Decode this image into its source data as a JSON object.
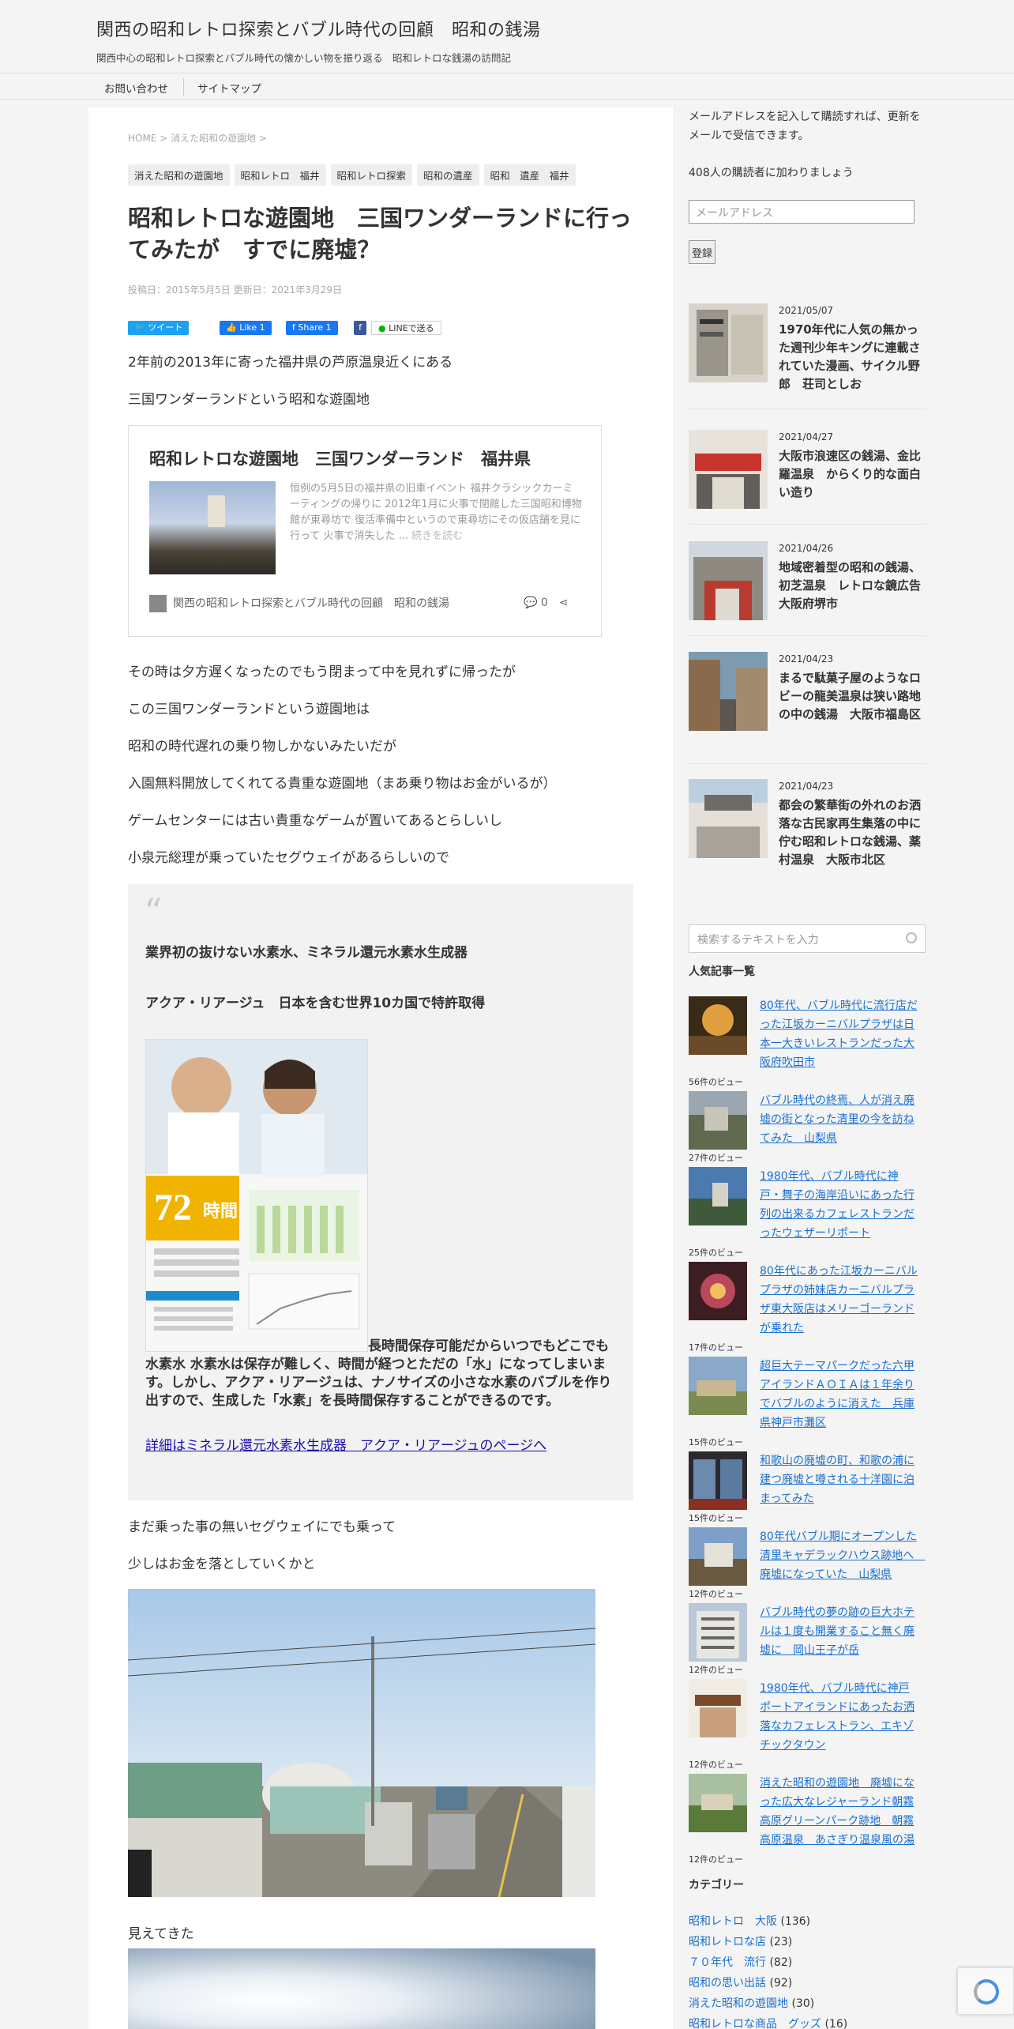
{
  "site": {
    "title": "関西の昭和レトロ探索とバブル時代の回顧　昭和の銭湯",
    "description": "関西中心の昭和レトロ探索とバブル時代の懐かしい物を振り返る　昭和レトロな銭湯の訪問記"
  },
  "nav": {
    "items": [
      {
        "label": "お問い合わせ"
      },
      {
        "label": "サイトマップ"
      }
    ]
  },
  "breadcrumb": {
    "home": "HOME",
    "sep": ">",
    "category": "消えた昭和の遊園地"
  },
  "tags": [
    "消えた昭和の遊園地",
    "昭和レトロ　福井",
    "昭和レトロ探索",
    "昭和の遺産",
    "昭和　遺産　福井"
  ],
  "post": {
    "title": "昭和レトロな遊園地　三国ワンダーランドに行ってみたが　すでに廃墟？",
    "date": "投稿日：2015年5月5日 更新日：2021年3月29日"
  },
  "share": {
    "tweet": "ツイート",
    "like": "Like 1",
    "fb_share": "Share 1",
    "line": "LINEで送る"
  },
  "paragraphs": {
    "p1": "2年前の2013年に寄った福井県の芦原温泉近くにある",
    "p2": "三国ワンダーランドという昭和な遊園地",
    "p3": "その時は夕方遅くなったのでもう閉まって中を見れずに帰ったが",
    "p4": "この三国ワンダーランドという遊園地は",
    "p5": "昭和の時代遅れの乗り物しかないみたいだが",
    "p6": "入園無料開放してくれてる貴重な遊園地（まあ乗り物はお金がいるが）",
    "p7": "ゲームセンターには古い貴重なゲームが置いてあるとらしいし",
    "p8": "小泉元総理が乗っていたセグウェイがあるらしいので",
    "p9": "まだ乗った事の無いセグウェイにでも乗って",
    "p10": "少しはお金を落としていくかと",
    "p11": "見えてきた"
  },
  "card": {
    "title": "昭和レトロな遊園地　三国ワンダーランド　福井県",
    "excerpt": "恒例の5月5日の福井県の旧車イベント 福井クラシックカーミーティングの帰りに 2012年1月に火事で閉館した三国昭和博物館が東尋坊で 復活準備中というので東尋坊にその仮店舗を見に行って 火事で消失した ...",
    "more": "続きを読む",
    "site": "関西の昭和レトロ探索とバブル時代の回顧　昭和の銭湯",
    "comments": "0"
  },
  "promo": {
    "heading1": "業界初の抜けない水素水、ミネラル還元水素水生成器",
    "heading2": "アクア・リアージュ　日本を含む世界10カ国で特許取得",
    "image_big_number": "72",
    "image_unit": "時間",
    "body": "長時間保存可能だからいつでもどこでも水素水 水素水は保存が難しく、時間が経つとただの「水」になってしまいます。しかし、アクア・リアージュは、ナノサイズの小さな水素のバブルを作り出すので、生成した「水素」を長時間保存することができるのです。",
    "link": "詳細はミネラル還元水素水生成器　アクア・リアージュのページへ"
  },
  "sidebar": {
    "subscribe_text": "メールアドレスを記入して購読すれば、更新をメールで受信できます。",
    "subscriber_count": "408人の購読者に加わりましょう",
    "email_placeholder": "メールアドレス",
    "subscribe_button": "登録",
    "search_placeholder": "検索するテキストを入力",
    "popular_heading": "人気記事一覧",
    "categories_heading": "カテゴリー",
    "recent": [
      {
        "date": "2021/05/07",
        "title": "1970年代に人気の無かった週刊少年キングに連載されていた漫画、サイクル野郎　荘司としお"
      },
      {
        "date": "2021/04/27",
        "title": "大阪市浪速区の銭湯、金比羅温泉　からくり的な面白い造り"
      },
      {
        "date": "2021/04/26",
        "title": "地域密着型の昭和の銭湯、初芝温泉　レトロな鏡広告　大阪府堺市"
      },
      {
        "date": "2021/04/23",
        "title": "まるで駄菓子屋のようなロビーの龍美温泉は狭い路地の中の銭湯　大阪市福島区"
      },
      {
        "date": "2021/04/23",
        "title": "都会の繁華街の外れのお洒落な古民家再生集落の中に佇む昭和レトロな銭湯、薬村温泉　大阪市北区"
      }
    ],
    "popular": [
      {
        "title": "80年代、バブル時代に流行店だった江坂カーニバルプラザは日本一大きいレストランだった大阪府吹田市",
        "views": "56件のビュー"
      },
      {
        "title": "バブル時代の終焉、人が消え廃墟の街となった清里の今を訪ねてみた　山梨県",
        "views": "27件のビュー"
      },
      {
        "title": "1980年代、バブル時代に神戸・舞子の海岸沿いにあった行列の出来るカフェレストランだったウェザーリポート",
        "views": "25件のビュー"
      },
      {
        "title": "80年代にあった江坂カーニバルプラザの姉妹店カーニバルプラザ東大阪店はメリーゴーランドが乗れた",
        "views": "17件のビュー"
      },
      {
        "title": "超巨大テーマパークだった六甲アイランドＡＯＩＡは１年余りでバブルのように消えた　兵庫県神戸市灘区",
        "views": "15件のビュー"
      },
      {
        "title": "和歌山の廃墟の町、和歌の浦に建つ廃墟と噂される十洋園に泊まってみた",
        "views": "15件のビュー"
      },
      {
        "title": "80年代バブル期にオープンした清里キャデラックハウス跡地へ　廃墟になっていた　山梨県",
        "views": "12件のビュー"
      },
      {
        "title": "バブル時代の夢の跡の巨大ホテルは１度も開業すること無く廃墟に　岡山王子が岳",
        "views": "12件のビュー"
      },
      {
        "title": "1980年代、バブル時代に神戸ポートアイランドにあったお洒落なカフェレストラン、エキゾチックタウン",
        "views": "12件のビュー"
      },
      {
        "title": "消えた昭和の遊園地　廃墟になった広大なレジャーランド朝霧高原グリーンパーク跡地　朝霧高原温泉　あさぎり温泉風の湯",
        "views": "12件のビュー"
      }
    ],
    "categories": [
      {
        "name": "昭和レトロ　大阪",
        "count": "(136)"
      },
      {
        "name": "昭和レトロな店",
        "count": "(23)"
      },
      {
        "name": "７０年代　流行",
        "count": "(82)"
      },
      {
        "name": "昭和の思い出話",
        "count": "(92)"
      },
      {
        "name": "消えた昭和の遊園地",
        "count": "(30)"
      },
      {
        "name": "昭和レトロな商品　グッズ",
        "count": "(16)"
      }
    ]
  },
  "colors": {
    "link": "#1a6fcf",
    "twitter": "#1da1f2",
    "facebook": "#1877f2",
    "line": "#00b900"
  }
}
